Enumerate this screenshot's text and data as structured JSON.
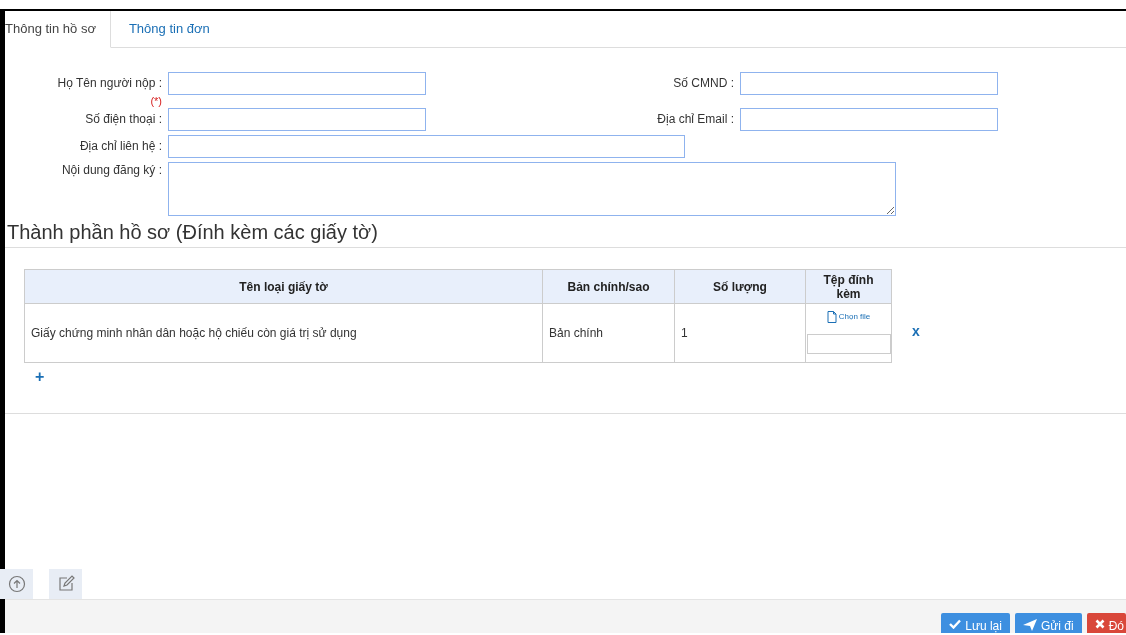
{
  "tabs": [
    {
      "label": "Thông tin hồ sơ",
      "selected": true
    },
    {
      "label": "Thông tin đơn",
      "selected": false
    }
  ],
  "form_rows": [
    {
      "kind": "pair",
      "fields": [
        {
          "label": "Họ Tên người nộp :",
          "required_mark": "(*)"
        },
        {
          "label": "Số CMND :"
        }
      ]
    },
    {
      "kind": "pair",
      "fields": [
        {
          "label": "Số điện thoại :"
        },
        {
          "label": "Địa chỉ Email :"
        }
      ]
    },
    {
      "kind": "wide",
      "fields": [
        {
          "label": "Địa chỉ liên hệ :"
        }
      ]
    },
    {
      "kind": "textarea",
      "fields": [
        {
          "label": "Nội dung đăng ký :"
        }
      ]
    }
  ],
  "section_title": "Thành phần hồ sơ (Đính kèm các giấy tờ)",
  "table": {
    "columns": [
      "Tên loại giấy tờ",
      "Bản chính/sao",
      "Số lượng",
      "Tệp đính kèm"
    ],
    "rows": [
      {
        "name": "Giấy chứng minh nhân dân hoặc hộ chiếu còn giá trị sử dụng",
        "copy_type": "Bản chính",
        "quantity": "1",
        "file_link": "Chọn file",
        "delete": "x"
      }
    ]
  },
  "add_row": "+",
  "footer_buttons": [
    {
      "label": "Lưu lại",
      "kind": "save"
    },
    {
      "label": "Gửi đi",
      "kind": "send"
    },
    {
      "label": "Đó",
      "kind": "close"
    }
  ]
}
